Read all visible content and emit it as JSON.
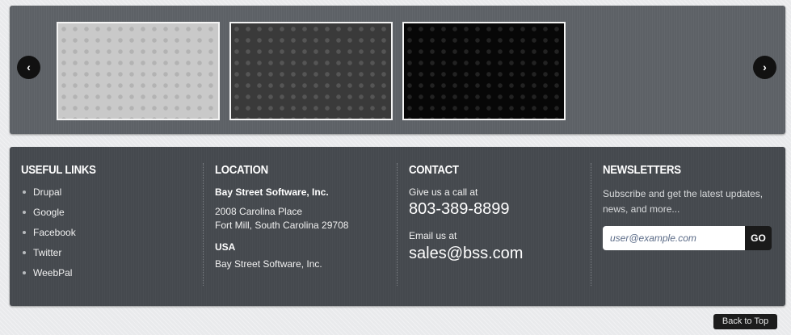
{
  "slider": {
    "prev_icon": "chevron-left-icon",
    "next_icon": "chevron-right-icon",
    "thumbnails": [
      {
        "theme": "light",
        "color": "#c9c9c9"
      },
      {
        "theme": "dark",
        "color": "#3a3a3a"
      },
      {
        "theme": "black",
        "color": "#070707"
      }
    ]
  },
  "footer": {
    "useful_links": {
      "title": "USEFUL LINKS",
      "items": [
        "Drupal",
        "Google",
        "Facebook",
        "Twitter",
        "WeebPal"
      ]
    },
    "location": {
      "title": "LOCATION",
      "company": "Bay Street Software, Inc.",
      "address_line1": "2008 Carolina Place",
      "address_line2": "Fort Mill, South Carolina 29708",
      "country": "USA",
      "company2": "Bay Street Software, Inc."
    },
    "contact": {
      "title": "CONTACT",
      "call_label": "Give us a call at",
      "phone": "803-389-8899",
      "email_label": "Email us at",
      "email": "sales@bss.com"
    },
    "newsletters": {
      "title": "NEWSLETTERS",
      "text": "Subscribe and get the latest updates, news, and more...",
      "placeholder": "user@example.com",
      "button_label": "GO"
    }
  },
  "back_to_top": "Back to Top",
  "colors": {
    "page_bg": "#e9eaec",
    "slider_bg": "#5d6166",
    "footer_bg": "#45494e",
    "button_dark": "#1a1a1a"
  }
}
